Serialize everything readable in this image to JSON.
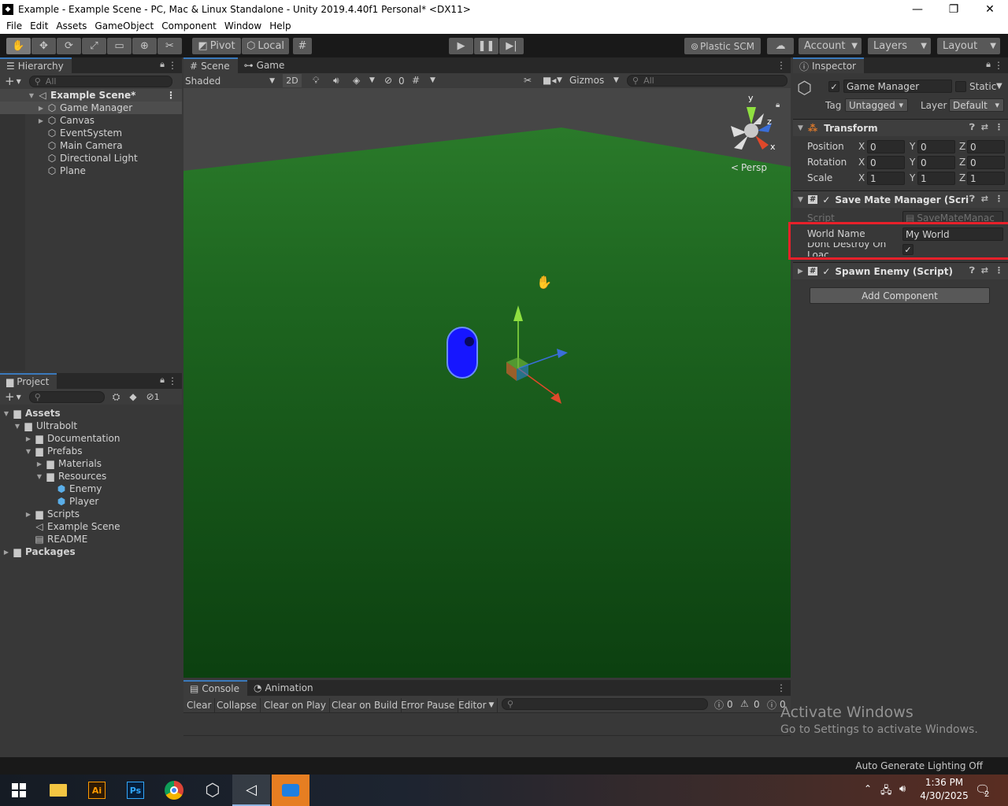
{
  "window": {
    "title": "Example - Example Scene - PC, Mac & Linux Standalone - Unity 2019.4.40f1 Personal* <DX11>",
    "minimize": "—",
    "maximize": "❐",
    "close": "✕"
  },
  "menu": [
    "File",
    "Edit",
    "Assets",
    "GameObject",
    "Component",
    "Window",
    "Help"
  ],
  "toolbar": {
    "pivot": "Pivot",
    "local": "Local",
    "plastic": "Plastic SCM",
    "account": "Account",
    "layers": "Layers",
    "layout": "Layout"
  },
  "hierarchy": {
    "tab": "Hierarchy",
    "search_placeholder": "All",
    "scene": "Example Scene*",
    "items": [
      "Game Manager",
      "Canvas",
      "EventSystem",
      "Main Camera",
      "Directional Light",
      "Plane"
    ]
  },
  "project": {
    "tab": "Project",
    "hidden_count": "1",
    "tree": [
      "Assets",
      "Ultrabolt",
      "Documentation",
      "Prefabs",
      "Materials",
      "Resources",
      "Enemy",
      "Player",
      "Scripts",
      "Example Scene",
      "README",
      "Packages"
    ]
  },
  "scene": {
    "tabs": [
      "Scene",
      "Game"
    ],
    "shading": "Shaded",
    "mode_2d": "2D",
    "hidden_count": "0",
    "gizmos": "Gizmos",
    "search_placeholder": "All",
    "persp": "Persp",
    "axis_y": "y",
    "axis_z": "z",
    "axis_x": "x"
  },
  "inspector": {
    "tab": "Inspector",
    "object_name": "Game Manager",
    "static_label": "Static",
    "tag_label": "Tag",
    "tag_value": "Untagged",
    "layer_label": "Layer",
    "layer_value": "Default",
    "transform": {
      "title": "Transform",
      "rows": [
        {
          "label": "Position",
          "x": "0",
          "y": "0",
          "z": "0"
        },
        {
          "label": "Rotation",
          "x": "0",
          "y": "0",
          "z": "0"
        },
        {
          "label": "Scale",
          "x": "1",
          "y": "1",
          "z": "1"
        }
      ]
    },
    "save_mate": {
      "title": "Save Mate Manager (Scri",
      "script_label": "Script",
      "script_value": "SaveMateManac",
      "world_name_label": "World Name",
      "world_name_value": "My World",
      "dont_destroy_label": "Dont Destroy On Loac"
    },
    "spawn_enemy": {
      "title": "Spawn Enemy (Script)"
    },
    "add_component": "Add Component"
  },
  "console": {
    "tabs": [
      "Console",
      "Animation"
    ],
    "buttons": [
      "Clear",
      "Collapse",
      "Clear on Play",
      "Clear on Build",
      "Error Pause",
      "Editor"
    ],
    "counts": [
      "0",
      "0",
      "0"
    ]
  },
  "watermark": {
    "line1": "Activate Windows",
    "line2": "Go to Settings to activate Windows."
  },
  "status": "Auto Generate Lighting Off",
  "taskbar": {
    "time": "1:36 PM",
    "date": "4/30/2025",
    "notifications": "2"
  },
  "colors": {
    "accent": "#3a79bb",
    "highlight_box": "#e8202a",
    "scene_ground": "#1e5a1e",
    "character": "#1a1aff"
  }
}
